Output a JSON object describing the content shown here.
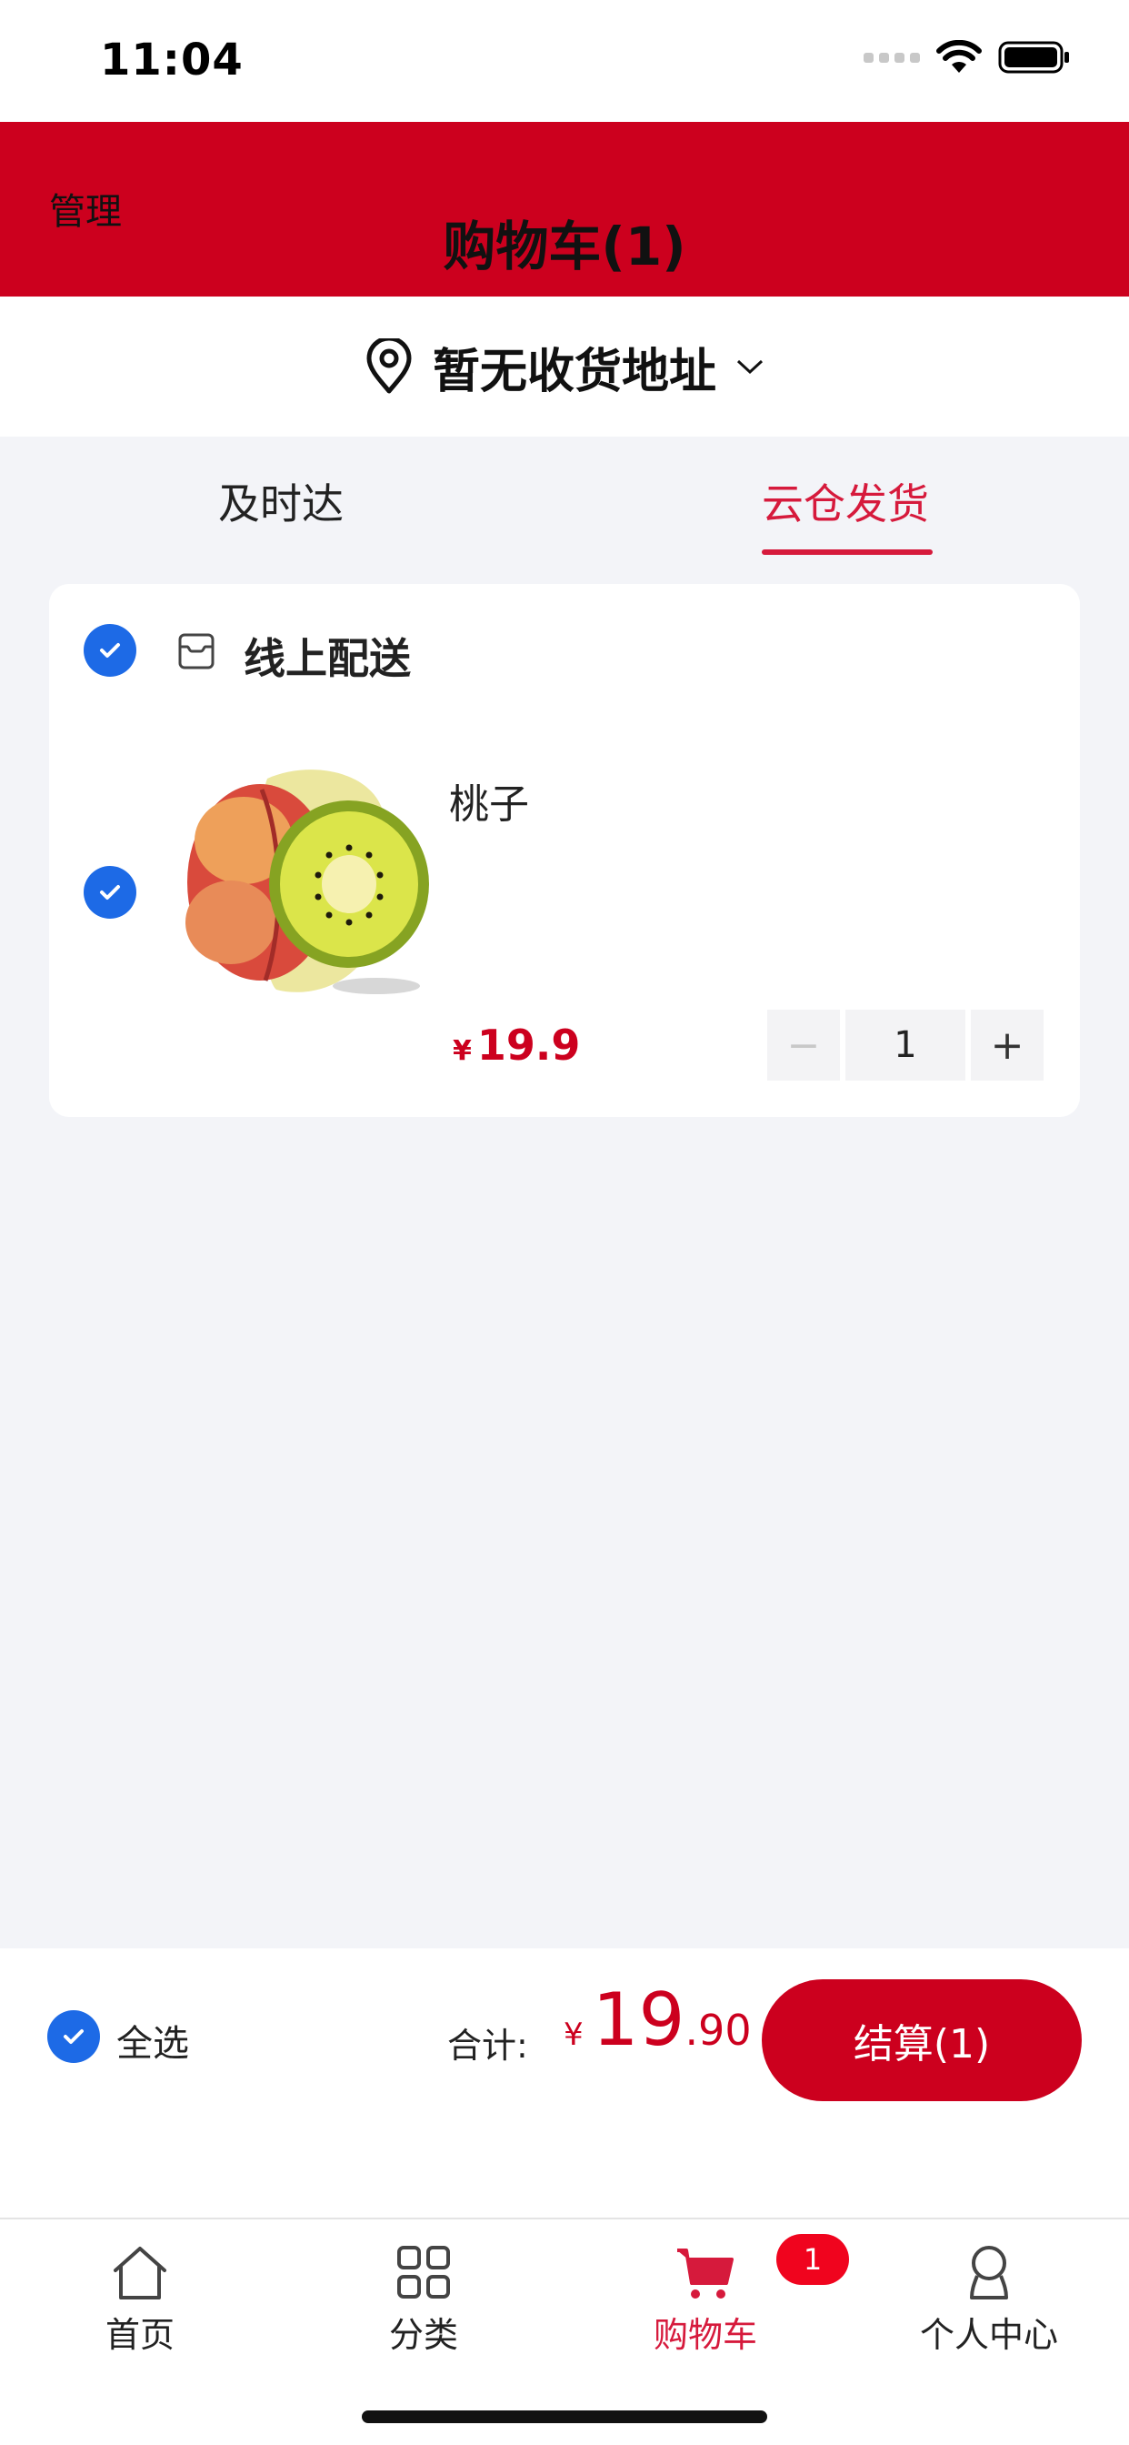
{
  "status_bar": {
    "time": "11:04"
  },
  "header": {
    "manage_label": "管理",
    "title": "购物车(1)"
  },
  "address": {
    "text": "暂无收货地址"
  },
  "tabs": [
    {
      "label": "及时达",
      "active": false
    },
    {
      "label": "云仓发货",
      "active": true
    }
  ],
  "cart": {
    "store_label": "线上配送",
    "items": [
      {
        "name": "桃子",
        "currency": "¥",
        "price": "19.9",
        "quantity": "1",
        "minus": "−",
        "plus": "+"
      }
    ]
  },
  "checkout": {
    "select_all_label": "全选",
    "total_label": "合计:",
    "currency": "¥",
    "total_int": "19",
    "total_dec": ".90",
    "button_label": "结算(1)"
  },
  "tabbar": {
    "items": [
      {
        "label": "首页",
        "icon": "home-icon"
      },
      {
        "label": "分类",
        "icon": "category-icon"
      },
      {
        "label": "购物车",
        "icon": "cart-icon",
        "active": true,
        "badge": "1"
      },
      {
        "label": "个人中心",
        "icon": "profile-icon"
      }
    ]
  },
  "colors": {
    "brand_red": "#cc001e",
    "accent_red": "#d61a3c",
    "check_blue": "#1d6ae6",
    "background": "#f3f4f8"
  }
}
